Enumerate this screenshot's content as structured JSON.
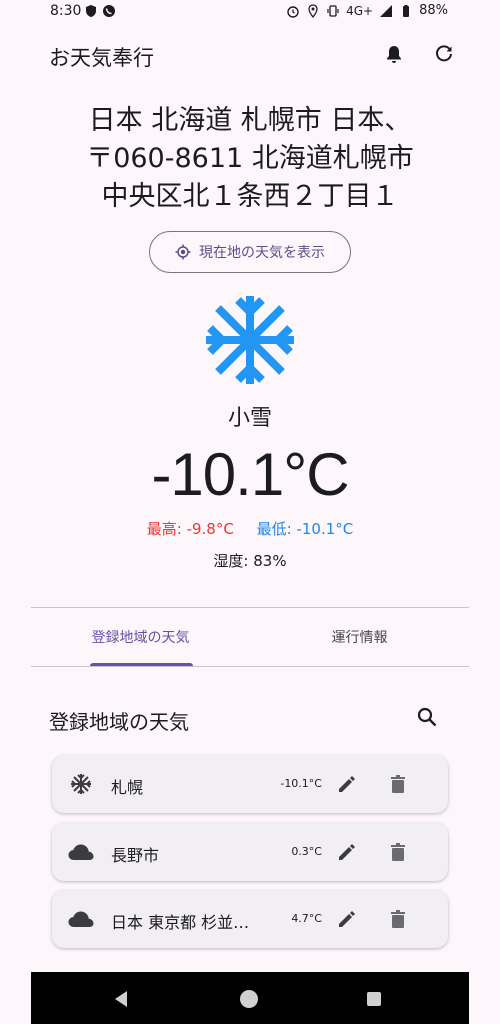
{
  "status": {
    "time": "8:30",
    "network": "4G+",
    "battery": "88%"
  },
  "app": {
    "title": "お天気奉行",
    "bell_icon": "bell-icon",
    "refresh_icon": "refresh-icon"
  },
  "location": {
    "line1": "日本 北海道 札幌市 日本、",
    "line2": "〒060-8611 北海道札幌市",
    "line3": "中央区北１条西２丁目１"
  },
  "current_button": {
    "label": "現在地の天気を表示",
    "icon": "my-location-icon"
  },
  "weather": {
    "icon": "snowflake-icon",
    "condition": "小雪",
    "temperature": "-10.1°C",
    "max": "最高: -9.8°C",
    "min": "最低: -10.1°C",
    "humidity": "湿度: 83%"
  },
  "tabs": [
    {
      "label": "登録地域の天気",
      "active": true
    },
    {
      "label": "運行情報",
      "active": false
    }
  ],
  "section": {
    "title": "登録地域の天気",
    "search_icon": "search-icon"
  },
  "locations": [
    {
      "icon": "snowflake-icon",
      "name": "札幌",
      "temp": "-10.1°C"
    },
    {
      "icon": "cloud-icon",
      "name": "長野市",
      "temp": "0.3°C"
    },
    {
      "icon": "cloud-icon",
      "name": "日本 東京都 杉並…",
      "temp": "4.7°C"
    }
  ],
  "colors": {
    "accent": "#6750a4",
    "max_temp": "#e53935",
    "min_temp": "#1e88e5",
    "snow_icon": "#2196f3"
  }
}
